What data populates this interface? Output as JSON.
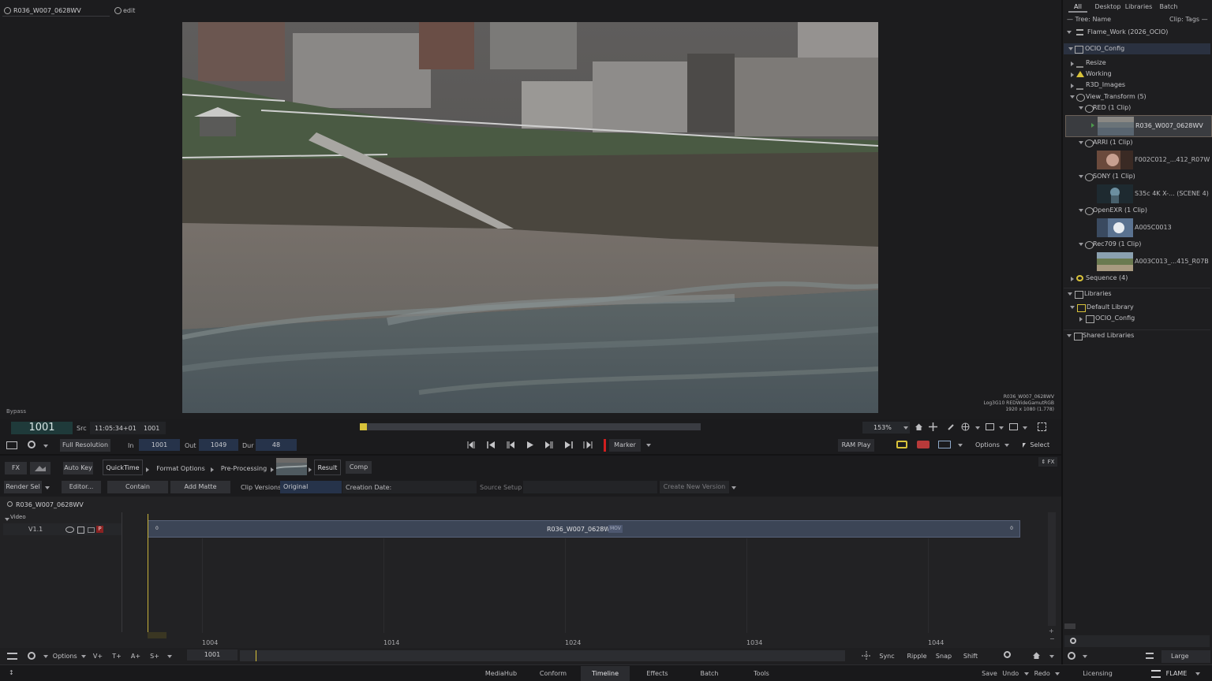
{
  "viewer": {
    "clip_tab": "R036_W007_0628WV",
    "edit_tab": "edit",
    "bypass": "Bypass",
    "overlay_name": "R036_W007_0628WV",
    "overlay_colorspace": "Log3G10 REDWideGamutRGB",
    "overlay_res": "1920 x 1080 (1.778)"
  },
  "transport": {
    "frame": "1001",
    "src_label": "Src",
    "timecode": "11:05:34+01",
    "src_frame": "1001",
    "zoom": "153%",
    "full_resolution": "Full Resolution",
    "in_label": "In",
    "in_value": "1001",
    "out_label": "Out",
    "out_value": "1049",
    "dur_label": "Dur",
    "dur_value": "48",
    "marker": "Marker",
    "ram_play": "RAM Play",
    "options": "Options",
    "select": "Select"
  },
  "tools": {
    "fx": "FX",
    "auto_key": "Auto Key",
    "quicktime": "QuickTime",
    "format_options": "Format Options",
    "pre_processing": "Pre-Processing",
    "result": "Result",
    "comp": "Comp",
    "fx_right": "FX",
    "render_sel": "Render Sel",
    "editor": "Editor...",
    "contain": "Contain",
    "add_matte": "Add Matte",
    "clip_versions": "Clip Versions",
    "original": "Original",
    "creation_date": "Creation Date:",
    "source_setup": "Source Setup",
    "create_new_version": "Create New Version"
  },
  "timeline": {
    "seq_name": "R036_W007_0628WV",
    "video_label": "Video",
    "track": "V1.1",
    "clip_name": "R036_W007_0628WV",
    "clip_badge": "MOV",
    "clip_start": "0",
    "clip_end": "0",
    "ticks": [
      "1004",
      "1014",
      "1024",
      "1034",
      "1044"
    ],
    "options": "Options",
    "v_plus": "V+",
    "t_plus": "T+",
    "a_plus": "A+",
    "s_plus": "S+",
    "frame": "1001",
    "sync": "Sync",
    "ripple": "Ripple",
    "snap": "Snap",
    "shift": "Shift"
  },
  "nav": {
    "tabs": [
      "MediaHub",
      "Conform",
      "Timeline",
      "Effects",
      "Batch",
      "Tools"
    ],
    "active": "Timeline",
    "save": "Save",
    "undo": "Undo",
    "redo": "Redo",
    "licensing": "Licensing",
    "flame": "FLAME"
  },
  "browser": {
    "tabs": [
      "All",
      "Desktop",
      "Libraries",
      "Batch"
    ],
    "tree_label": "— Tree: Name",
    "clip_label": "Clip: Tags —",
    "workspace": "Flame_Work (2026_OCIO)",
    "ocio_config": "OCIO_Config",
    "resize": "Resize",
    "working": "Working",
    "r3d_images": "R3D_Images",
    "view_transform": "View_Transform (5)",
    "red": "RED (1 Clip)",
    "red_clip": "R036_W007_0628WV",
    "arri": "ARRI (1 Clip)",
    "arri_clip": "F002C012_...412_R07W",
    "sony": "SONY (1 Clip)",
    "sony_clip": "S35c 4K X-... (SCENE 4)",
    "openexr": "OpenEXR (1 Clip)",
    "openexr_clip": "A005C0013",
    "rec709": "Rec709 (1 Clip)",
    "rec709_clip": "A003C013_...415_R07B",
    "sequence": "Sequence (4)",
    "libraries": "Libraries",
    "default_library": "Default Library",
    "lib_ocio": "OCIO_Config",
    "shared_libraries": "Shared Libraries",
    "large": "Large"
  },
  "colors": {
    "accent_gold": "#d8c23a",
    "selection_blue": "#26334a",
    "marker_red": "#d11f1f"
  }
}
